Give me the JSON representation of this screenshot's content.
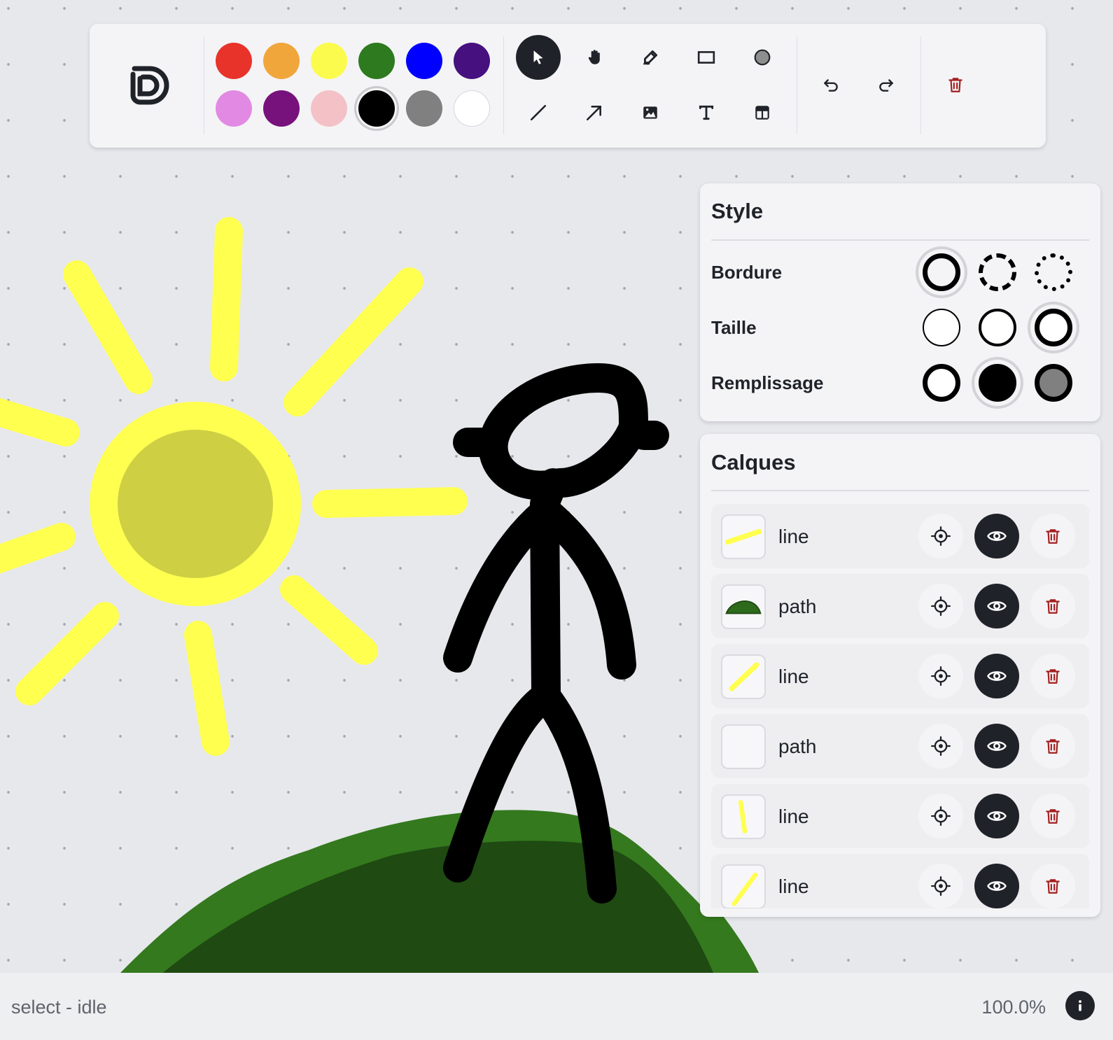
{
  "app": {
    "logo": "drawing-app-logo"
  },
  "palette": {
    "colors": [
      "#e8332a",
      "#f1a63c",
      "#fbfb4d",
      "#2d7a1f",
      "#0000ff",
      "#46107f",
      "#e28ae3",
      "#77127d",
      "#f3c1c6",
      "#000000",
      "#808080",
      "#ffffff"
    ],
    "selected": "#000000"
  },
  "tools": {
    "items": [
      {
        "name": "select",
        "icon": "cursor-icon",
        "active": true
      },
      {
        "name": "hand",
        "icon": "hand-icon"
      },
      {
        "name": "draw",
        "icon": "pencil-icon"
      },
      {
        "name": "rectangle",
        "icon": "rectangle-icon"
      },
      {
        "name": "ellipse",
        "icon": "circle-icon"
      },
      {
        "name": "line",
        "icon": "line-icon"
      },
      {
        "name": "arrow",
        "icon": "arrow-icon"
      },
      {
        "name": "image",
        "icon": "image-icon"
      },
      {
        "name": "text",
        "icon": "text-icon"
      },
      {
        "name": "table",
        "icon": "table-icon"
      }
    ],
    "history": [
      "undo-icon",
      "redo-icon"
    ],
    "delete": "trash-icon",
    "delete_color": "#a32020"
  },
  "style_panel": {
    "title": "Style",
    "rows": [
      {
        "label": "Bordure",
        "options": [
          "solid",
          "dashed",
          "dotted"
        ],
        "selected": 0
      },
      {
        "label": "Taille",
        "options": [
          "thin",
          "medium",
          "thick"
        ],
        "selected": 2
      },
      {
        "label": "Remplissage",
        "options": [
          "none",
          "solid",
          "semi"
        ],
        "selected": 1
      }
    ]
  },
  "layers_panel": {
    "title": "Calques",
    "layers": [
      {
        "name": "line",
        "thumb": "yellow-line-flat"
      },
      {
        "name": "path",
        "thumb": "green-mound"
      },
      {
        "name": "line",
        "thumb": "yellow-line-diagonal"
      },
      {
        "name": "path",
        "thumb": "empty"
      },
      {
        "name": "line",
        "thumb": "yellow-line-vertical"
      },
      {
        "name": "line",
        "thumb": "yellow-line-steep"
      }
    ],
    "actions": [
      "locate-icon",
      "eye-icon",
      "trash-icon"
    ]
  },
  "status": {
    "text": "select - idle",
    "zoom": "100.0%"
  },
  "colors": {
    "accent_dark": "#1f2329",
    "sun_ray": "#ffff50",
    "sun_core": "#cfcf44",
    "hill_outer": "#34791e",
    "hill_inner": "#1f4a12",
    "ink": "#000000"
  }
}
